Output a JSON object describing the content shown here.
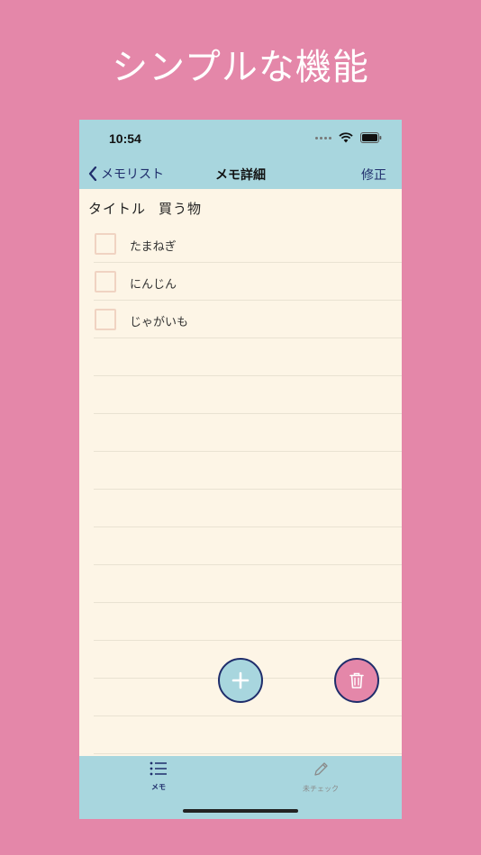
{
  "headline": "シンプルな機能",
  "status_bar": {
    "time": "10:54"
  },
  "nav": {
    "back_label": "メモリスト",
    "title": "メモ詳細",
    "edit_label": "修正"
  },
  "memo": {
    "title_label": "タイトル",
    "title_value": "買う物",
    "items": [
      {
        "label": "たまねぎ",
        "checked": false
      },
      {
        "label": "にんじん",
        "checked": false
      },
      {
        "label": "じゃがいも",
        "checked": false
      }
    ]
  },
  "tab_bar": {
    "tabs": [
      {
        "label": "メモ",
        "icon": "list-icon",
        "active": true
      },
      {
        "label": "未チェック",
        "icon": "pencil-icon",
        "active": false
      }
    ]
  },
  "colors": {
    "background": "#e487a9",
    "bar": "#a8d6de",
    "paper": "#fdf5e6",
    "accent": "#1f2d6b"
  }
}
